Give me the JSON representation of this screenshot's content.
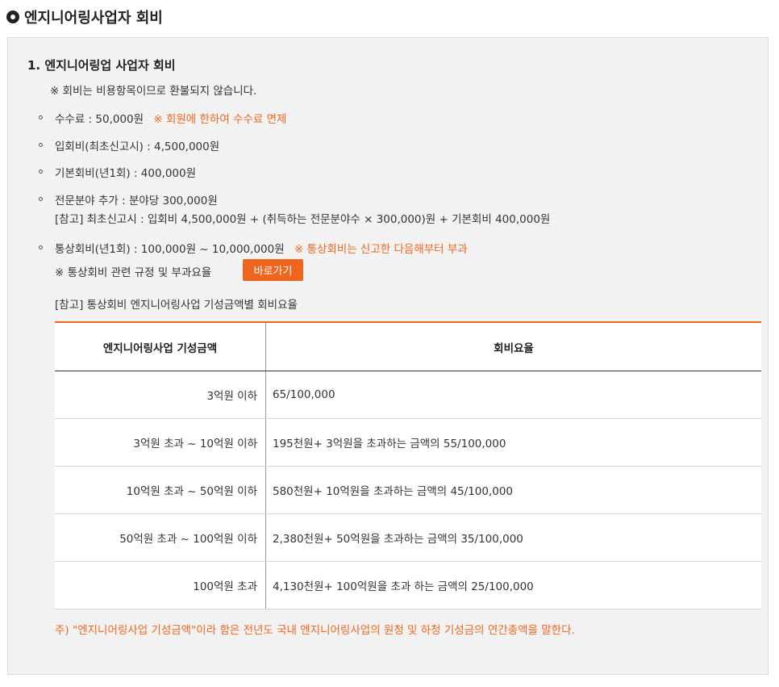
{
  "heading": "엔지니어링사업자 회비",
  "section": {
    "title": "1. 엔지니어링업 사업자 회비",
    "non_refund_notice": "※ 회비는 비용항목이므로 환불되지 않습니다."
  },
  "items": [
    {
      "text": "수수료 : 50,000원",
      "note": "※ 회원에 한하여 수수료 면제"
    },
    {
      "text": "입회비(최초신고시) : 4,500,000원"
    },
    {
      "text": "기본회비(년1회) : 400,000원"
    },
    {
      "text": "전문분야 추가 : 분야당 300,000원",
      "sub": "[참고] 최초신고시 : 입회비 4,500,000원 + (취득하는 전문분야수 × 300,000)원 + 기본회비 400,000원"
    },
    {
      "text": "통상회비(년1회) : 100,000원 ~ 10,000,000원",
      "note": "※ 통상회비는 신고한 다음해부터 부과",
      "sub": "※ 통상회비 관련 규정 및 부과요율"
    }
  ],
  "go_button": "바로가기",
  "table_caption": "[참고] 통상회비 엔지니어링사업 기성금액별 회비요율",
  "table": {
    "headers": [
      "엔지니어링사업 기성금액",
      "회비요율"
    ],
    "rows": [
      [
        "3억원 이하",
        "65/100,000"
      ],
      [
        "3억원 초과 ~ 10억원 이하",
        "195천원+ 3억원을 초과하는 금액의 55/100,000"
      ],
      [
        "10억원 초과 ~ 50억원 이하",
        "580천원+ 10억원을 초과하는 금액의 45/100,000"
      ],
      [
        "50억원 초과 ~ 100억원 이하",
        "2,380천원+ 50억원을 초과하는 금액의 35/100,000"
      ],
      [
        "100억원 초과",
        "4,130천원+ 100억원을 초과 하는 금액의 25/100,000"
      ]
    ]
  },
  "footnote": "주) \"엔지니어링사업 기성금액\"이라 함은 전년도 국내 엔지니어링사업의 원청 및 하청 기성금의 연간총액을 말한다.",
  "colors": {
    "accent": "#f0651e",
    "panel": "#f2f2f2"
  }
}
